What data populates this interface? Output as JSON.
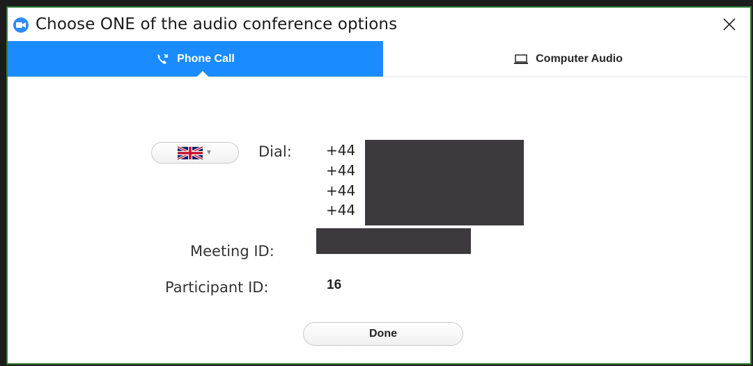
{
  "window": {
    "title": "Choose ONE of the audio conference options",
    "close_icon": "close-icon"
  },
  "tabs": [
    {
      "label": "Phone Call",
      "icon": "phone-call-icon",
      "active": true
    },
    {
      "label": "Computer Audio",
      "icon": "laptop-icon",
      "active": false
    }
  ],
  "phone": {
    "country_selector": {
      "icon": "uk-flag-icon"
    },
    "dial_label": "Dial:",
    "dial_numbers": [
      "+44",
      "+44",
      "+44",
      "+44"
    ],
    "meeting_id_label": "Meeting ID:",
    "participant_id_label": "Participant ID:",
    "participant_id_value": "16"
  },
  "actions": {
    "done_label": "Done"
  },
  "colors": {
    "accent": "#1a8cff",
    "redaction": "#3c3a3d",
    "border": "#2e7d32"
  }
}
